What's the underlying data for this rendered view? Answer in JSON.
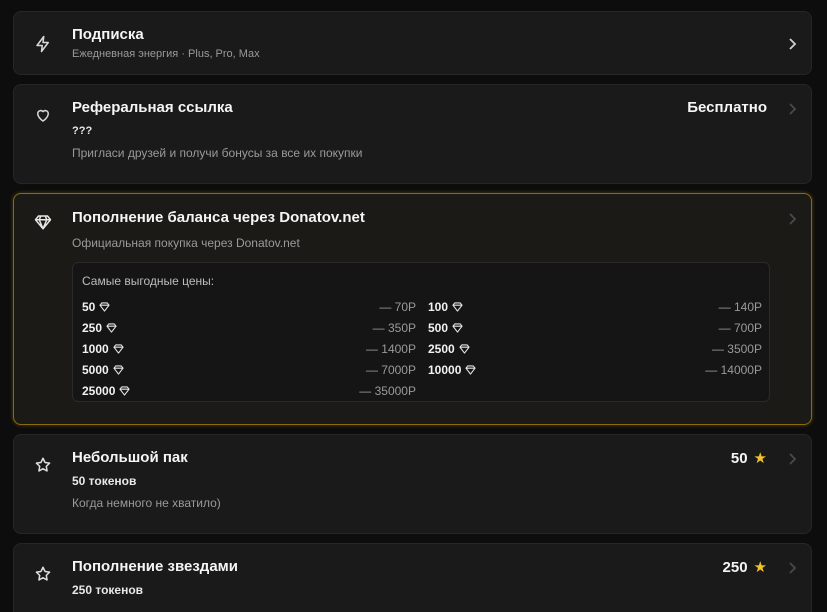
{
  "cards": {
    "subscription": {
      "title": "Подписка",
      "subtitle": "Ежедневная энергия · Plus, Pro, Max",
      "icon": "lightning-icon"
    },
    "referral": {
      "title": "Реферальная ссылка",
      "code": "???",
      "subtitle": "Пригласи друзей и получи бонусы за все их покупки",
      "price": "Бесплатно",
      "icon": "heart-icon"
    },
    "donatov": {
      "title": "Пополнение баланса через Donatov.net",
      "subtitle": "Официальная покупка через Donatov.net",
      "icon": "diamond-icon",
      "prices_heading": "Самые выгодные цены:",
      "left_column": [
        {
          "amount": "50",
          "cost": "— 70Р"
        },
        {
          "amount": "250",
          "cost": "— 350Р"
        },
        {
          "amount": "1000",
          "cost": "— 1400Р"
        },
        {
          "amount": "5000",
          "cost": "— 7000Р"
        },
        {
          "amount": "25000",
          "cost": "— 35000Р"
        }
      ],
      "right_column": [
        {
          "amount": "100",
          "cost": "— 140Р"
        },
        {
          "amount": "500",
          "cost": "— 700Р"
        },
        {
          "amount": "2500",
          "cost": "— 3500Р"
        },
        {
          "amount": "10000",
          "cost": "— 14000Р"
        }
      ]
    },
    "small_pack": {
      "title": "Небольшой пак",
      "tokens": "50 токенов",
      "subtitle": "Когда немного не хватило)",
      "price": "50",
      "icon": "star-outline-icon"
    },
    "stars_topup": {
      "title": "Пополнение звездами",
      "tokens": "250 токенов",
      "price": "250",
      "icon": "star-outline-icon"
    }
  },
  "colors": {
    "background": "#0d0d0d",
    "card": "#1a1a1a",
    "highlight_border": "#8a6a0e",
    "star": "#f2c12e"
  }
}
